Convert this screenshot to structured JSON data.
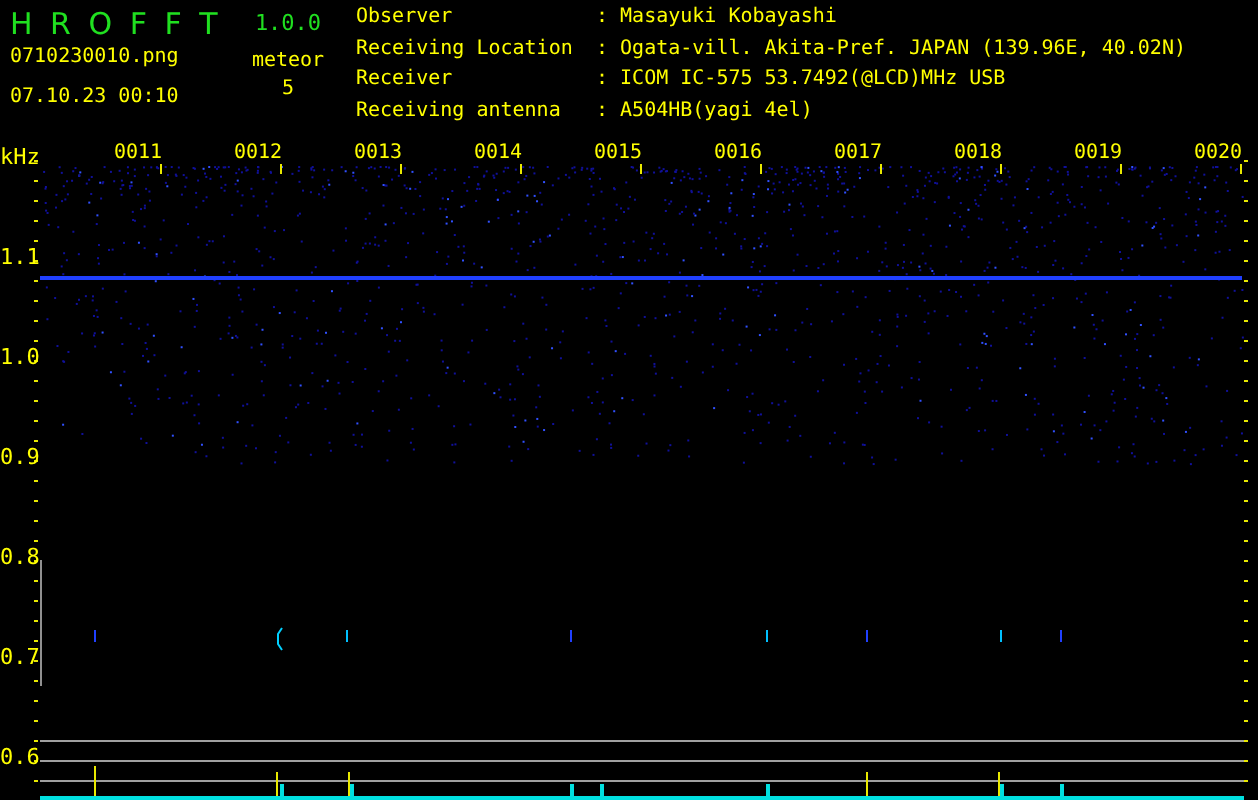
{
  "app": {
    "name": "H R O F F T",
    "version": "1.0.0",
    "file": "0710230010.png",
    "timestamp": "07.10.23 00:10",
    "count_label": "meteor",
    "count": "5"
  },
  "info": [
    {
      "label": "Observer",
      "separator": ":",
      "value": "Masayuki Kobayashi"
    },
    {
      "label": "Receiving Location",
      "separator": ":",
      "value": "Ogata-vill. Akita-Pref. JAPAN (139.96E, 40.02N)"
    },
    {
      "label": "Receiver",
      "separator": ":",
      "value": "ICOM IC-575 53.7492(@LCD)MHz USB"
    },
    {
      "label": "Receiving antenna",
      "separator": ":",
      "value": "A504HB(yagi 4el)"
    }
  ],
  "plot": {
    "unit": "kHz",
    "freq_labels": [
      "1.1",
      "1.0",
      "0.9",
      "0.8",
      "0.7",
      "0.6"
    ],
    "time_labels": [
      "0011",
      "0012",
      "0013",
      "0014",
      "0015",
      "0016",
      "0017",
      "0018",
      "0019",
      "0020"
    ]
  }
}
